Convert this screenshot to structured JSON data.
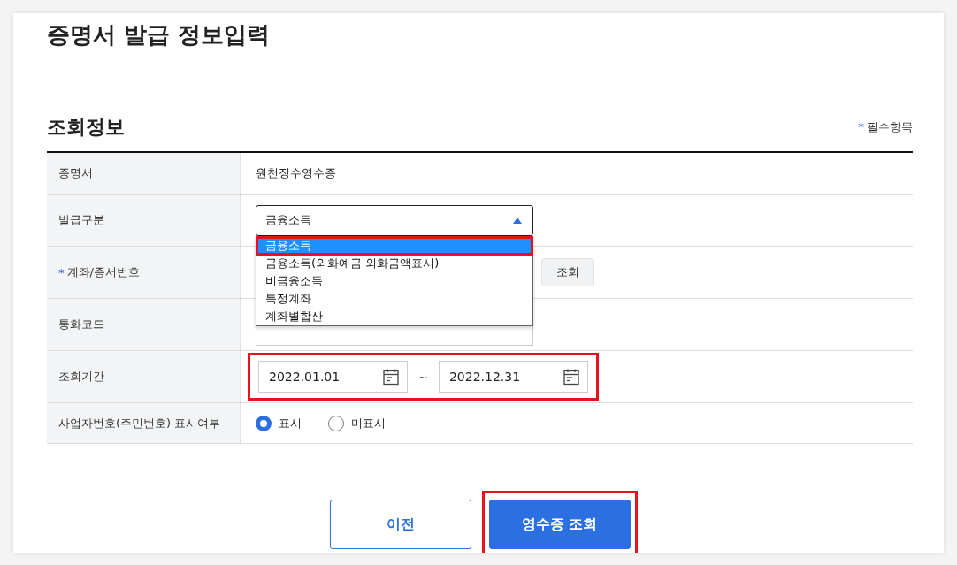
{
  "page_title": "증명서 발급 정보입력",
  "section_title": "조회정보",
  "required_note": {
    "mark": "*",
    "text": "필수항목"
  },
  "rows": [
    {
      "kind": "text",
      "label": "증명서",
      "value": "원천징수영수증"
    },
    {
      "kind": "select",
      "label": "발급구분",
      "value": "금융소득",
      "expanded": true,
      "options": [
        {
          "label": "금융소득",
          "selected": true,
          "highlighted": true
        },
        {
          "label": "금융소득(외화예금 외화금액표시)",
          "selected": false,
          "highlighted": false
        },
        {
          "label": "비금융소득",
          "selected": false,
          "highlighted": false
        },
        {
          "label": "특정계좌",
          "selected": false,
          "highlighted": false
        },
        {
          "label": "계좌별합산",
          "selected": false,
          "highlighted": false
        }
      ]
    },
    {
      "kind": "account",
      "label": "계좌/증서번호",
      "required": true,
      "button": "조회"
    },
    {
      "kind": "covered_select",
      "label": "통화코드"
    },
    {
      "kind": "date_range",
      "label": "조회기간",
      "start": "2022.01.01",
      "separator": "~",
      "end": "2022.12.31",
      "highlighted": true
    },
    {
      "kind": "radio",
      "label": "사업자번호(주민번호) 표시여부",
      "options": [
        {
          "label": "표시",
          "selected": true
        },
        {
          "label": "미표시",
          "selected": false
        }
      ]
    }
  ],
  "buttons": [
    {
      "label": "이전",
      "kind": "secondary",
      "highlighted": false
    },
    {
      "label": "영수증 조회",
      "kind": "primary",
      "highlighted": true
    }
  ]
}
